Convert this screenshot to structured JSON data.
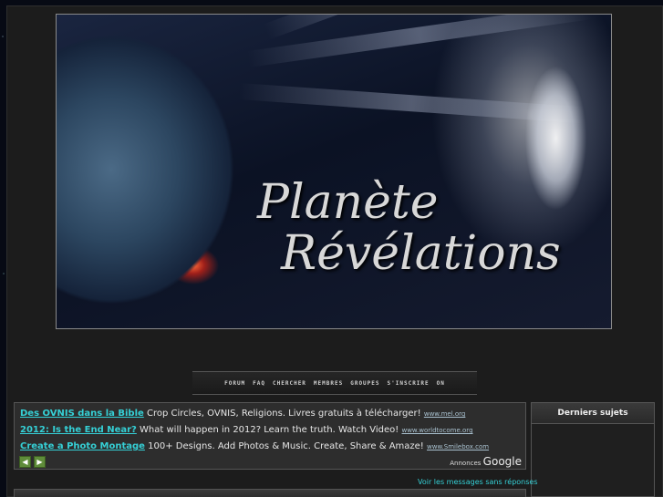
{
  "banner": {
    "title_line1": "Planète",
    "title_line2": "Révélations"
  },
  "nav": {
    "items": [
      "FORUM",
      "FAQ",
      "CHERCHER",
      "MEMBRES",
      "GROUPES",
      "S'INSCRIRE",
      "ON"
    ]
  },
  "ads": {
    "rows": [
      {
        "title": "Des OVNIS dans la Bible",
        "text": "Crop Circles, OVNIS, Religions. Livres gratuits à télécharger!",
        "url": "www.mel.org"
      },
      {
        "title": "2012: Is the End Near?",
        "text": "What will happen in 2012? Learn the truth. Watch Video!",
        "url": "www.worldtocome.org"
      },
      {
        "title": "Create a Photo Montage",
        "text": "100+ Designs. Add Photos & Music. Create, Share & Amaze!",
        "url": "www.Smilebox.com"
      }
    ],
    "ads_by_label": "Annonces",
    "ads_by_brand": "Google",
    "prev_icon": "chevron-left-icon",
    "next_icon": "chevron-right-icon"
  },
  "sidebar": {
    "header": "Derniers sujets"
  },
  "links": {
    "view_no_reply": "Voir les messages sans réponses"
  },
  "colors": {
    "link": "#35d0d6",
    "panel_bg": "#2d2d2d",
    "page_bg": "#1c1c1c"
  }
}
